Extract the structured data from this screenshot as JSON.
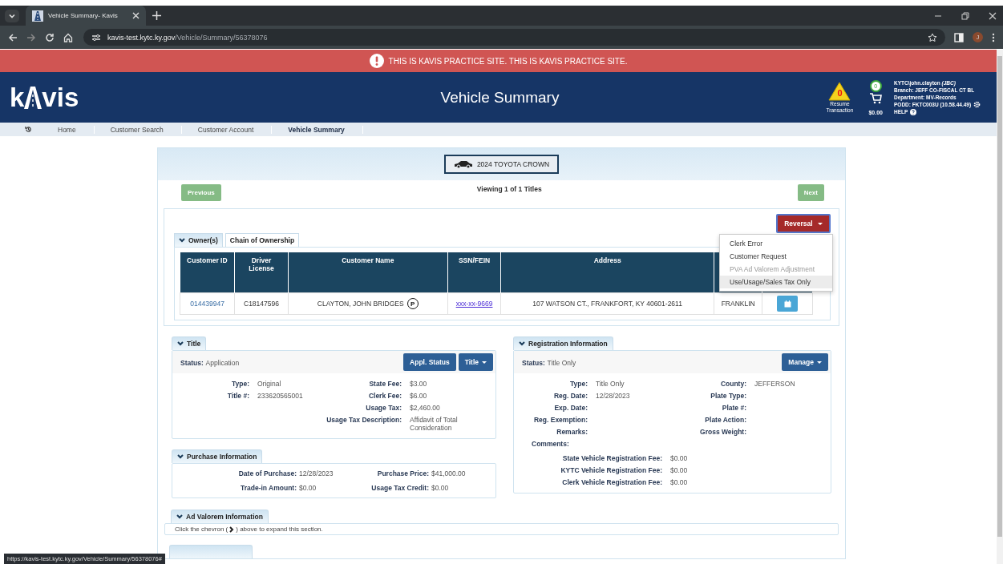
{
  "browser": {
    "tab_title": "Vehicle Summary- Kavis",
    "url_host": "kavis-test.kytc.ky.gov",
    "url_path": "/Vehicle/Summary/56378076",
    "profile_initial": "J"
  },
  "banner": "THIS IS KAVIS PRACTICE SITE. THIS IS KAVIS PRACTICE SITE.",
  "header": {
    "logo_left": "k",
    "logo_right": "vis",
    "title": "Vehicle Summary",
    "resume_count": "0",
    "resume_label": "Resume Transaction",
    "cart_count": "0",
    "cart_total": "$0.00",
    "user": "KYTC\\john.clayton *(JBC)*",
    "branch": "Branch: JEFF CO-FISCAL CT BL",
    "department": "Department: MV-Records",
    "podd": "PODD: FKTC003U (10.58.44.49)",
    "help": "HELP"
  },
  "breadcrumbs": [
    {
      "label": "Home",
      "selected": false
    },
    {
      "label": "Customer Search",
      "selected": false
    },
    {
      "label": "Customer Account",
      "selected": false
    },
    {
      "label": "Vehicle Summary",
      "selected": true
    }
  ],
  "vehicle": "2024 TOYOTA CROWN",
  "pager": {
    "previous": "Previous",
    "viewing": "Viewing 1 of 1 Titles",
    "next": "Next"
  },
  "reversal": {
    "label": "Reversal",
    "menu": [
      {
        "label": "Clerk Error",
        "disabled": false,
        "highlighted": false
      },
      {
        "label": "Customer Request",
        "disabled": false,
        "highlighted": false
      },
      {
        "label": "PVA Ad Valorem Adjustment",
        "disabled": true,
        "highlighted": false
      },
      {
        "label": "Use/Usage/Sales Tax Only",
        "disabled": false,
        "highlighted": true
      }
    ]
  },
  "owner_tabs": [
    {
      "label": "Owner(s)",
      "selected": true
    },
    {
      "label": "Chain of Ownership",
      "selected": false
    }
  ],
  "owners_table": {
    "columns": [
      "Customer ID",
      "Driver License",
      "Customer Name",
      "SSN/FEIN",
      "Address"
    ],
    "rows": [
      {
        "customer_id": "014439947",
        "driver_license": "C18147596",
        "name": "CLAYTON, JOHN BRIDGES",
        "badge": "P",
        "ssn": "xxx-xx-9669",
        "address": "107 WATSON CT., FRANKFORT, KY 40601-2611",
        "column_6": "FRANKLIN"
      }
    ]
  },
  "title_panel": {
    "tab": "Title",
    "status_label": "Status:",
    "status": "Application",
    "buttons": [
      {
        "label": "Appl. Status",
        "caret": false
      },
      {
        "label": "Title",
        "caret": true
      }
    ],
    "left": [
      {
        "label": "Type:",
        "value": "Original"
      },
      {
        "label": "Title #:",
        "value": "233620565001"
      }
    ],
    "right": [
      {
        "label": "State Fee:",
        "value": "$3.00"
      },
      {
        "label": "Clerk Fee:",
        "value": "$6.00"
      },
      {
        "label": "Usage Tax:",
        "value": "$2,460.00"
      },
      {
        "label": "Usage Tax Description:",
        "value": "Affidavit of Total Consideration"
      }
    ]
  },
  "purchase_panel": {
    "tab": "Purchase Information",
    "left": [
      {
        "label": "Date of Purchase:",
        "value": "12/28/2023"
      },
      {
        "label": "Trade-in Amount:",
        "value": "$0.00"
      }
    ],
    "right": [
      {
        "label": "Purchase Price:",
        "value": "$41,000.00"
      },
      {
        "label": "Usage Tax Credit:",
        "value": "$0.00"
      }
    ]
  },
  "registration_panel": {
    "tab": "Registration Information",
    "status_label": "Status:",
    "status": "Title Only",
    "buttons": [
      {
        "label": "Manage",
        "caret": true
      }
    ],
    "left": [
      {
        "label": "Type:",
        "value": "Title Only"
      },
      {
        "label": "Reg. Date:",
        "value": "12/28/2023"
      },
      {
        "label": "Exp. Date:"
      },
      {
        "label": "Reg. Exemption:"
      },
      {
        "label": "Remarks:"
      }
    ],
    "right": [
      {
        "label": "County:",
        "value": "JEFFERSON"
      },
      {
        "label": "Plate Type:"
      },
      {
        "label": "Plate #:"
      },
      {
        "label": "Plate Action:"
      },
      {
        "label": "Gross Weight:"
      }
    ],
    "comments_label": "Comments:",
    "fees": [
      {
        "label": "State Vehicle Registration Fee:",
        "value": "$0.00"
      },
      {
        "label": "KYTC Vehicle Registration Fee:",
        "value": "$0.00"
      },
      {
        "label": "Clerk Vehicle Registration Fee:",
        "value": "$0.00"
      }
    ]
  },
  "ad_valorem_panel": {
    "tab": "Ad Valorem Information",
    "hint_before": "Click the chevron (",
    "hint_after": ") above to expand this section."
  },
  "status_url": "https://kavis-test.kytc.ky.gov/Vehicle/Summary/56378076#"
}
